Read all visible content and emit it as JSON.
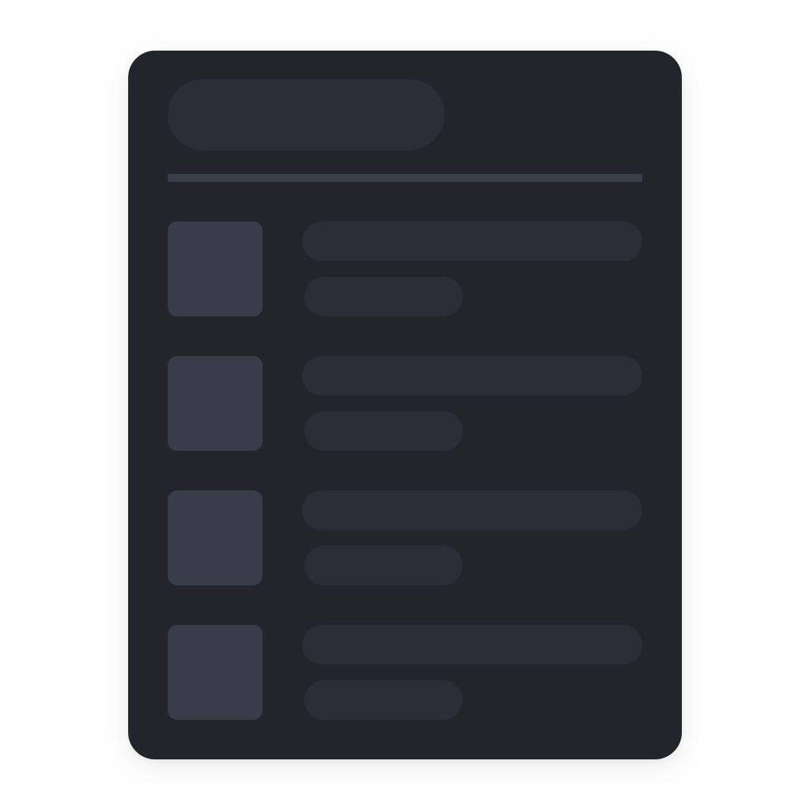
{
  "colors": {
    "page_background": "#ffffff",
    "card_background": "#24242d",
    "placeholder_light": "#2d2d37",
    "placeholder_thumb": "#393d4a",
    "divider": "#3a3e4b"
  },
  "skeleton": {
    "rows": [
      {
        "id": 1
      },
      {
        "id": 2
      },
      {
        "id": 3
      },
      {
        "id": 4
      }
    ]
  }
}
